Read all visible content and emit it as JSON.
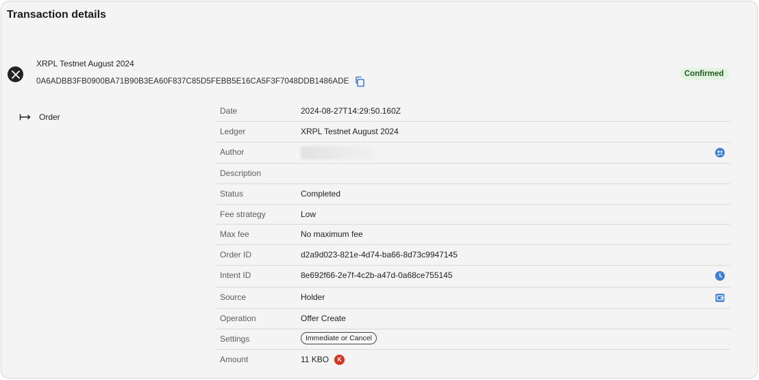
{
  "page": {
    "title": "Transaction details"
  },
  "transaction": {
    "ledger_name": "XRPL Testnet August 2024",
    "hash": "0A6ADBB3FB0900BA71B90B3EA60F837C85D5FEBB5E16CA5F3F7048DDB1486ADE",
    "status": "Confirmed",
    "type": "Order"
  },
  "details": [
    {
      "label": "Date",
      "value": "2024-08-27T14:29:50.160Z"
    },
    {
      "label": "Ledger",
      "value": "XRPL Testnet August 2024"
    },
    {
      "label": "Author",
      "value": ""
    },
    {
      "label": "Description",
      "value": ""
    },
    {
      "label": "Status",
      "value": "Completed"
    },
    {
      "label": "Fee strategy",
      "value": "Low"
    },
    {
      "label": "Max fee",
      "value": "No maximum fee"
    },
    {
      "label": "Order ID",
      "value": "d2a9d023-821e-4d74-ba66-8d73c9947145"
    },
    {
      "label": "Intent ID",
      "value": "8e692f66-2e7f-4c2b-a47d-0a68ce755145"
    },
    {
      "label": "Source",
      "value": "Holder"
    },
    {
      "label": "Operation",
      "value": "Offer Create"
    },
    {
      "label": "Settings",
      "value": "Immediate or Cancel"
    },
    {
      "label": "Amount",
      "value": "11 KBO",
      "token_letter": "K"
    }
  ],
  "colors": {
    "confirmed_bg": "#e3f3e2",
    "confirmed_text": "#1e5a1e",
    "accent_blue": "#3f7fd8",
    "token_red": "#d8321f"
  },
  "icons": {
    "ledger": "xrpl-logo-icon",
    "copy": "copy-icon",
    "type": "arrow-to-right-icon",
    "author": "user-group-icon",
    "intent": "clock-icon",
    "source": "wallet-icon"
  }
}
